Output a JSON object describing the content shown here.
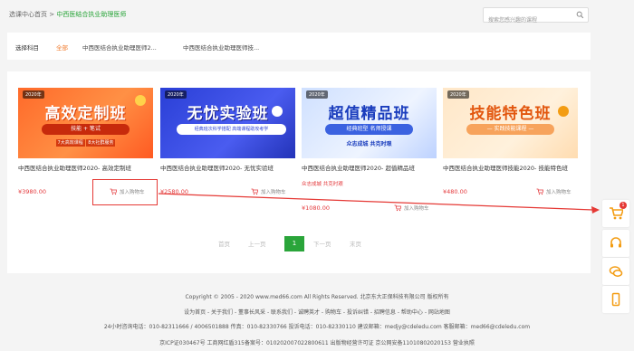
{
  "breadcrumb": {
    "home": "选课中心首页",
    "separator": ">",
    "current": "中西医结合执业助理医师"
  },
  "search": {
    "placeholder": "搜索您感兴趣的课程"
  },
  "filter": {
    "label": "选择科目",
    "options": [
      "全部",
      "中西医结合执业助理医师2...",
      "中西医结合执业助理医师技..."
    ],
    "selected": "全部"
  },
  "products": [
    {
      "tag": "2020年",
      "banner_title": "高效定制班",
      "banner_sub": "技能 + 笔试",
      "banner_foot": [
        "7大高效课程",
        "8大社群服务"
      ],
      "name": "中西医结合执业助理医师2020- 高效定制班",
      "price": "¥3980.00",
      "cart": "加入购物车"
    },
    {
      "tag": "2020年",
      "banner_title": "无忧实验班",
      "banner_sub": "经典班次科学搭配  高端课程助攻考学",
      "banner_foot": [],
      "name": "中西医结合执业助理医师2020- 无忧实验班",
      "price": "¥2580.00",
      "cart": "加入购物车"
    },
    {
      "tag": "2020年",
      "banner_title": "超值精品班",
      "banner_sub": "经典班型  名师授课",
      "banner_foot": [
        "众志成城  共克时艰"
      ],
      "name": "中西医结合执业助理医师2020- 超值精品班",
      "extra": "众志成城 共克时艰",
      "price": "¥1080.00",
      "cart": "加入购物车"
    },
    {
      "tag": "2020年",
      "banner_title": "技能特色班",
      "banner_sub": "— 实践技能课程 —",
      "banner_foot": [],
      "name": "中西医结合执业助理医师技能2020- 技能特色班",
      "price": "¥480.00",
      "cart": "加入购物车"
    }
  ],
  "pagination": {
    "first": "首页",
    "prev": "上一页",
    "current": "1",
    "next": "下一页",
    "last": "末页"
  },
  "footer": {
    "copyright": "Copyright © 2005 - 2020 www.med66.com All Rights Reserved.   北京东大正保科技有限公司 版权所有",
    "links": "设为首页 - 关于我们 - 董事长风采 - 联系我们 - 诚聘英才 - 购物车 - 投诉纠错 - 招聘信息 - 帮助中心 - 网站地图",
    "contacts": "24小时咨询电话：010-82311666 / 4006501888   传真：010-82330766   投诉电话：010-82330110   建议邮箱：medjy@cdeledu.com   客服邮箱：med66@cdeledu.com",
    "license": "京ICP证030467号    工商网红盾315备案号：010202007022800611    出版物经营许可证    京公网安备11010802020153    营业执照"
  },
  "sidebar": {
    "cart_count": "1"
  },
  "colors": {
    "accent_green": "#2aa53a",
    "price_red": "#e4393c",
    "filter_orange": "#f0792a",
    "side_orange": "#f39c12"
  }
}
